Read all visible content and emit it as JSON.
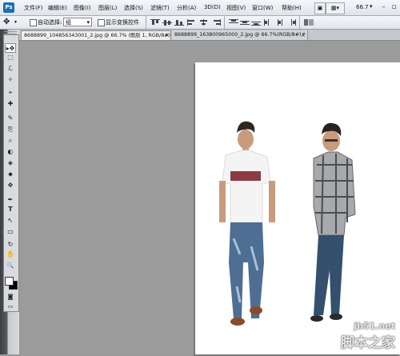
{
  "app": {
    "logo": "Ps"
  },
  "menu": [
    "文件(F)",
    "编辑(E)",
    "图像(I)",
    "图层(L)",
    "选择(S)",
    "滤镜(T)",
    "分析(A)",
    "3D(D)",
    "视图(V)",
    "窗口(W)",
    "帮助(H)"
  ],
  "menubar_right": {
    "zoom": "66.7",
    "zoom_arrow": "▾"
  },
  "options": {
    "auto_select_label": "自动选择:",
    "auto_select_value": "组",
    "show_transform_label": "显示变换控件"
  },
  "tabs": [
    {
      "label": "8688899_104856343001_2.jpg @ 66.7% (图层 1, RGB/8#) *",
      "active": true
    },
    {
      "label": "8688899_163800965000_2.jpg @ 66.7%(RGB/8#) *",
      "active": false
    }
  ],
  "tools": [
    "▸✥",
    "⬚",
    "ℒ",
    "✧",
    "⌖",
    "✚",
    "✎",
    "⎘",
    "⌕",
    "◐",
    "◈",
    "⬥",
    "✥",
    "T",
    "↖",
    "▭",
    "✋",
    "🔍"
  ],
  "watermark": {
    "url": "jb51.net",
    "name": "脚本之家"
  },
  "colors": {
    "accent": "#1a6fb5",
    "canvas_bg": "#9b9b9b",
    "document_bg": "#ffffff"
  }
}
